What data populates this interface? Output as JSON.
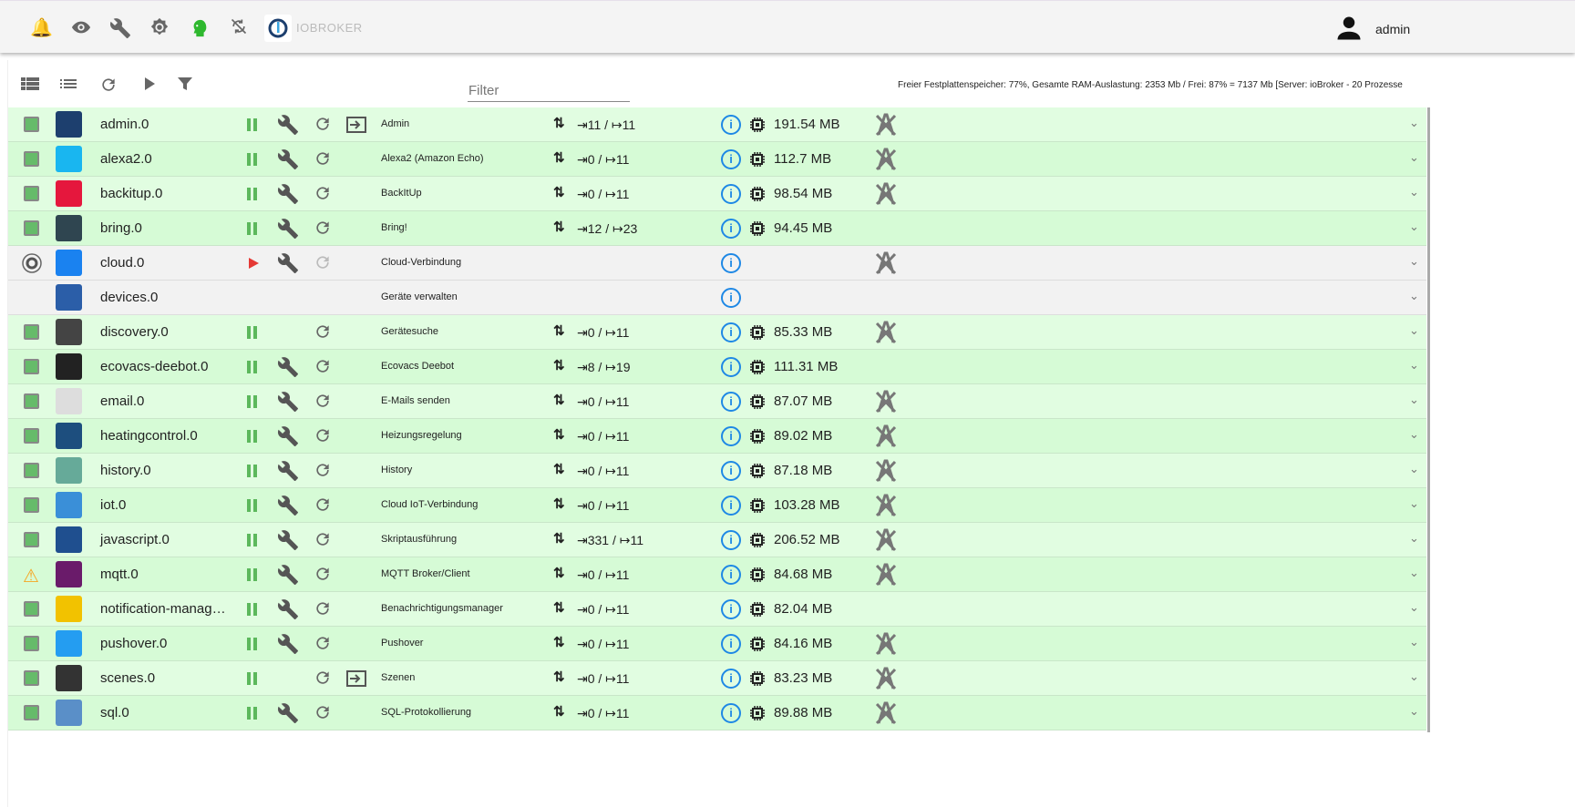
{
  "header": {
    "brand": "IOBROKER",
    "user": "admin",
    "icons": [
      "bell-icon",
      "eye-icon",
      "wrench-icon",
      "gear-icon",
      "head-icon",
      "sync-disabled-icon"
    ]
  },
  "toolbar": {
    "filter_placeholder": "Filter",
    "stats": "Freier Festplattenspeicher: 77%, Gesamte RAM-Auslastung: 2353 Mb / Frei: 87% = 7137 Mb [Server: ioBroker - 20 Prozesse"
  },
  "colors": {
    "running": "#5cb85c",
    "stopped": "#e53935",
    "info": "#1e88e5"
  },
  "adapters": [
    {
      "name": "admin.0",
      "title": "Admin",
      "state": "running",
      "wrench": true,
      "link": true,
      "conn": "⇥11 / ↦11",
      "mem": "191.54 MB",
      "nolog": true,
      "color": "#1d3f6e"
    },
    {
      "name": "alexa2.0",
      "title": "Alexa2 (Amazon Echo)",
      "state": "running",
      "wrench": true,
      "link": false,
      "conn": "⇥0 / ↦11",
      "mem": "112.7 MB",
      "nolog": true,
      "color": "#19b6f0"
    },
    {
      "name": "backitup.0",
      "title": "BackItUp",
      "state": "running",
      "wrench": true,
      "link": false,
      "conn": "⇥0 / ↦11",
      "mem": "98.54 MB",
      "nolog": true,
      "color": "#e5173d"
    },
    {
      "name": "bring.0",
      "title": "Bring!",
      "state": "running",
      "wrench": true,
      "link": false,
      "conn": "⇥12 / ↦23",
      "mem": "94.45 MB",
      "nolog": false,
      "color": "#2f4550"
    },
    {
      "name": "cloud.0",
      "title": "Cloud-Verbindung",
      "state": "stopped",
      "wrench": true,
      "link": false,
      "conn": "",
      "mem": "",
      "nolog": true,
      "color": "#1a82f0"
    },
    {
      "name": "devices.0",
      "title": "Geräte verwalten",
      "state": "none",
      "wrench": false,
      "link": false,
      "conn": "",
      "mem": "",
      "nolog": false,
      "color": "#2b5ea8"
    },
    {
      "name": "discovery.0",
      "title": "Gerätesuche",
      "state": "running",
      "wrench": false,
      "link": false,
      "conn": "⇥0 / ↦11",
      "mem": "85.33 MB",
      "nolog": true,
      "color": "#444"
    },
    {
      "name": "ecovacs-deebot.0",
      "title": "Ecovacs Deebot",
      "state": "running",
      "wrench": true,
      "link": false,
      "conn": "⇥8 / ↦19",
      "mem": "111.31 MB",
      "nolog": false,
      "color": "#222"
    },
    {
      "name": "email.0",
      "title": "E-Mails senden",
      "state": "running",
      "wrench": true,
      "link": false,
      "conn": "⇥0 / ↦11",
      "mem": "87.07 MB",
      "nolog": true,
      "color": "#ddd"
    },
    {
      "name": "heatingcontrol.0",
      "title": "Heizungsregelung",
      "state": "running",
      "wrench": true,
      "link": false,
      "conn": "⇥0 / ↦11",
      "mem": "89.02 MB",
      "nolog": true,
      "color": "#1d4e7e"
    },
    {
      "name": "history.0",
      "title": "History",
      "state": "running",
      "wrench": true,
      "link": false,
      "conn": "⇥0 / ↦11",
      "mem": "87.18 MB",
      "nolog": true,
      "color": "#6a9"
    },
    {
      "name": "iot.0",
      "title": "Cloud IoT-Verbindung",
      "state": "running",
      "wrench": true,
      "link": false,
      "conn": "⇥0 / ↦11",
      "mem": "103.28 MB",
      "nolog": true,
      "color": "#3a8fd8"
    },
    {
      "name": "javascript.0",
      "title": "Skriptausführung",
      "state": "running",
      "wrench": true,
      "link": false,
      "conn": "⇥331 / ↦11",
      "mem": "206.52 MB",
      "nolog": true,
      "color": "#1f4f8f"
    },
    {
      "name": "mqtt.0",
      "title": "MQTT Broker/Client",
      "state": "running",
      "warning": true,
      "wrench": true,
      "link": false,
      "conn": "⇥0 / ↦11",
      "mem": "84.68 MB",
      "nolog": true,
      "color": "#6a1b6a"
    },
    {
      "name": "notification-manag…",
      "title": "Benachrichtigungsmanager",
      "state": "running",
      "wrench": true,
      "link": false,
      "conn": "⇥0 / ↦11",
      "mem": "82.04 MB",
      "nolog": false,
      "color": "#f2c200"
    },
    {
      "name": "pushover.0",
      "title": "Pushover",
      "state": "running",
      "wrench": true,
      "link": false,
      "conn": "⇥0 / ↦11",
      "mem": "84.16 MB",
      "nolog": true,
      "color": "#249df1"
    },
    {
      "name": "scenes.0",
      "title": "Szenen",
      "state": "running",
      "wrench": false,
      "link": true,
      "conn": "⇥0 / ↦11",
      "mem": "83.23 MB",
      "nolog": true,
      "color": "#333"
    },
    {
      "name": "sql.0",
      "title": "SQL-Protokollierung",
      "state": "running",
      "wrench": true,
      "link": false,
      "conn": "⇥0 / ↦11",
      "mem": "89.88 MB",
      "nolog": true,
      "color": "#5a8fc8"
    }
  ]
}
